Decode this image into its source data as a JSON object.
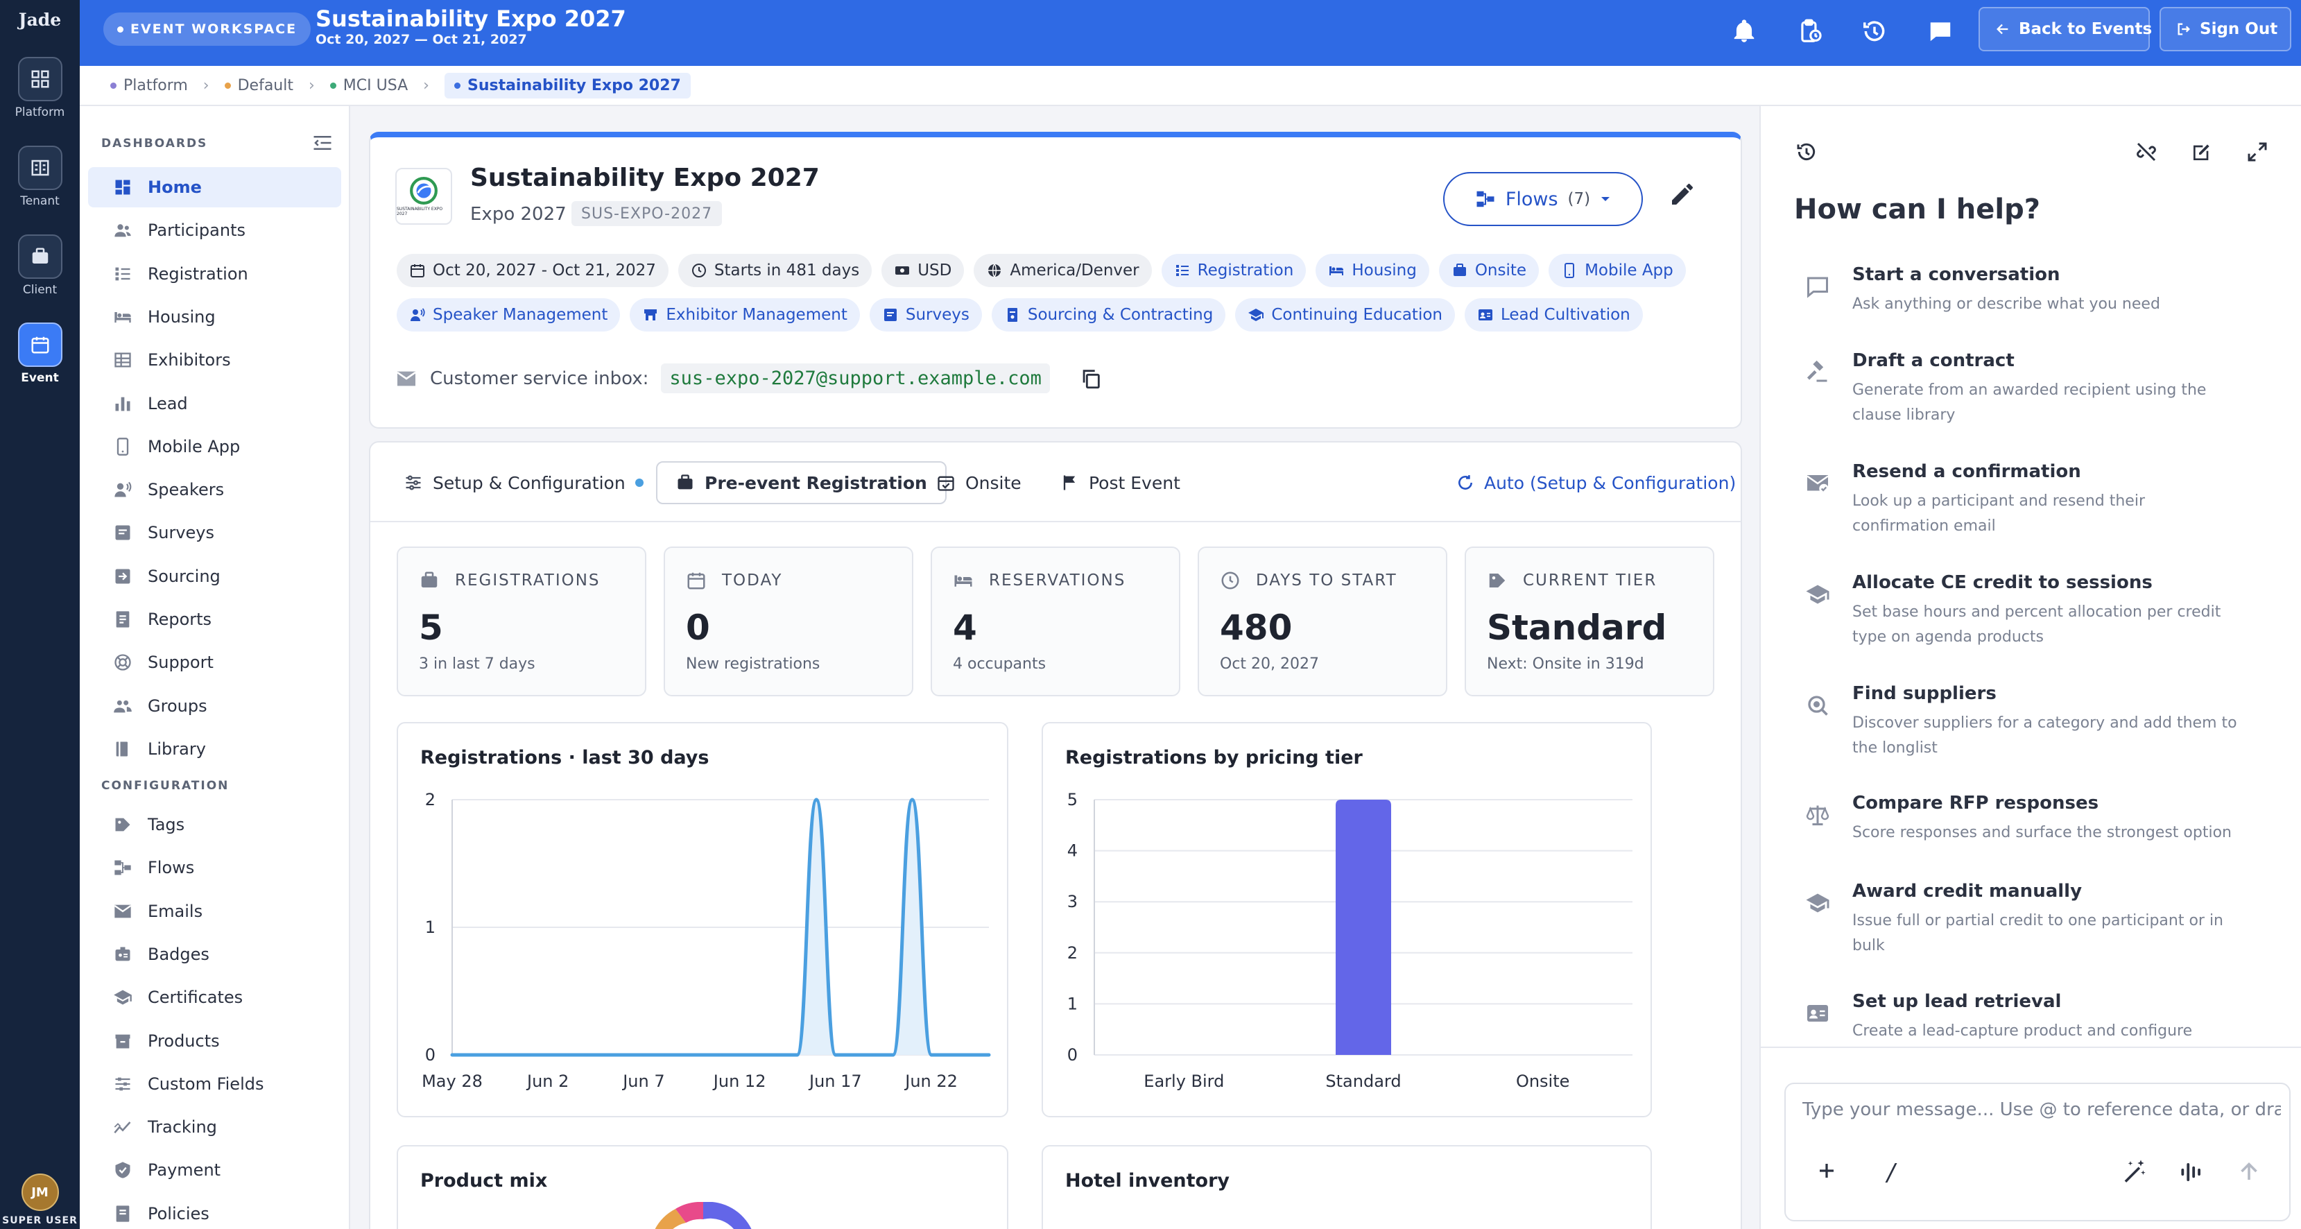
{
  "rail": {
    "logo": "Jade",
    "items": [
      {
        "label": "Platform",
        "icon": "grid-icon"
      },
      {
        "label": "Tenant",
        "icon": "building-icon"
      },
      {
        "label": "Client",
        "icon": "briefcase-icon"
      },
      {
        "label": "Event",
        "icon": "calendar-icon",
        "active": true
      }
    ],
    "user_initials": "JM",
    "user_role": "SUPER USER"
  },
  "topbar": {
    "workspace_label": "EVENT WORKSPACE",
    "title": "Sustainability Expo 2027",
    "dates": "Oct 20, 2027 — Oct 21, 2027",
    "back_label": "Back to Events",
    "signout_label": "Sign Out",
    "icons": [
      "bell-icon",
      "clipboard-clock-icon",
      "history-icon",
      "chat-icon"
    ]
  },
  "breadcrumb": [
    {
      "label": "Platform",
      "color": "#8b7fd4"
    },
    {
      "label": "Default",
      "color": "#e8a24a"
    },
    {
      "label": "MCI USA",
      "color": "#3daa78"
    },
    {
      "label": "Sustainability Expo 2027",
      "color": "#3b6ee0",
      "current": true
    }
  ],
  "sidebar": {
    "dashboards_heading": "DASHBOARDS",
    "configuration_heading": "CONFIGURATION",
    "dashboards": [
      {
        "label": "Home",
        "icon": "dashboard-icon",
        "active": true
      },
      {
        "label": "Participants",
        "icon": "people-icon"
      },
      {
        "label": "Registration",
        "icon": "registration-icon"
      },
      {
        "label": "Housing",
        "icon": "bed-icon"
      },
      {
        "label": "Exhibitors",
        "icon": "table-icon"
      },
      {
        "label": "Lead",
        "icon": "bar-chart-icon"
      },
      {
        "label": "Mobile App",
        "icon": "phone-icon"
      },
      {
        "label": "Speakers",
        "icon": "speaker-icon"
      },
      {
        "label": "Surveys",
        "icon": "survey-icon"
      },
      {
        "label": "Sourcing",
        "icon": "sourcing-icon"
      },
      {
        "label": "Reports",
        "icon": "report-icon"
      },
      {
        "label": "Support",
        "icon": "support-icon"
      },
      {
        "label": "Groups",
        "icon": "group-icon"
      },
      {
        "label": "Library",
        "icon": "library-icon"
      }
    ],
    "configuration": [
      {
        "label": "Tags",
        "icon": "tag-icon"
      },
      {
        "label": "Flows",
        "icon": "flow-icon"
      },
      {
        "label": "Emails",
        "icon": "email-icon"
      },
      {
        "label": "Badges",
        "icon": "badge-icon"
      },
      {
        "label": "Certificates",
        "icon": "certificate-icon"
      },
      {
        "label": "Products",
        "icon": "product-icon"
      },
      {
        "label": "Custom Fields",
        "icon": "sliders-icon"
      },
      {
        "label": "Tracking",
        "icon": "tracking-icon"
      },
      {
        "label": "Payment",
        "icon": "shield-icon"
      },
      {
        "label": "Policies",
        "icon": "policy-icon"
      }
    ]
  },
  "event": {
    "name": "Sustainability Expo 2027",
    "short_name": "Expo 2027",
    "code": "SUS-EXPO-2027",
    "logo_text": "SUSTAINABILITY EXPO 2027",
    "flows_label": "Flows",
    "flows_count": "(7)",
    "chips_row1": [
      {
        "label": "Oct 20, 2027 - Oct 21, 2027",
        "icon": "calendar-icon",
        "style": "gray"
      },
      {
        "label": "Starts in 481 days",
        "icon": "clock-icon",
        "style": "gray"
      },
      {
        "label": "USD",
        "icon": "money-icon",
        "style": "gray"
      },
      {
        "label": "America/Denver",
        "icon": "globe-icon",
        "style": "gray"
      },
      {
        "label": "Registration",
        "icon": "registration-icon",
        "style": "blue"
      },
      {
        "label": "Housing",
        "icon": "bed-icon",
        "style": "blue"
      },
      {
        "label": "Onsite",
        "icon": "briefcase-icon",
        "style": "blue"
      },
      {
        "label": "Mobile App",
        "icon": "phone-icon",
        "style": "blue"
      }
    ],
    "chips_row2": [
      {
        "label": "Speaker Management",
        "icon": "speaker-icon",
        "style": "blue"
      },
      {
        "label": "Exhibitor Management",
        "icon": "booth-icon",
        "style": "blue"
      },
      {
        "label": "Surveys",
        "icon": "survey-icon",
        "style": "blue"
      },
      {
        "label": "Sourcing & Contracting",
        "icon": "contract-icon",
        "style": "blue"
      },
      {
        "label": "Continuing Education",
        "icon": "mortarboard-icon",
        "style": "blue"
      },
      {
        "label": "Lead Cultivation",
        "icon": "id-card-icon",
        "style": "blue"
      }
    ],
    "inbox_label": "Customer service inbox:",
    "inbox_email": "sus-expo-2027@support.example.com"
  },
  "tabs": {
    "items": [
      {
        "label": "Setup & Configuration",
        "icon": "sliders-icon",
        "dot": true
      },
      {
        "label": "Pre-event Registration",
        "icon": "briefcase-icon",
        "selected": true
      },
      {
        "label": "Onsite",
        "icon": "calendar-check-icon"
      },
      {
        "label": "Post Event",
        "icon": "flag-icon"
      }
    ],
    "auto_label": "Auto (Setup & Configuration)"
  },
  "stats": [
    {
      "label": "REGISTRATIONS",
      "value": "5",
      "sub": "3 in last 7 days",
      "icon": "briefcase-icon"
    },
    {
      "label": "TODAY",
      "value": "0",
      "sub": "New registrations",
      "icon": "calendar-icon"
    },
    {
      "label": "RESERVATIONS",
      "value": "4",
      "sub": "4 occupants",
      "icon": "bed-icon"
    },
    {
      "label": "DAYS TO START",
      "value": "480",
      "sub": "Oct 20, 2027",
      "icon": "clock-icon"
    },
    {
      "label": "CURRENT TIER",
      "value": "Standard",
      "sub": "Next: Onsite in 319d",
      "icon": "tag-icon"
    }
  ],
  "chart_data": [
    {
      "type": "area",
      "title": "Registrations · last 30 days",
      "x": [
        "May 28",
        "May 29",
        "May 30",
        "May 31",
        "Jun 1",
        "Jun 2",
        "Jun 3",
        "Jun 4",
        "Jun 5",
        "Jun 6",
        "Jun 7",
        "Jun 8",
        "Jun 9",
        "Jun 10",
        "Jun 11",
        "Jun 12",
        "Jun 13",
        "Jun 14",
        "Jun 15",
        "Jun 16",
        "Jun 17",
        "Jun 18",
        "Jun 19",
        "Jun 20",
        "Jun 21",
        "Jun 22",
        "Jun 23",
        "Jun 24",
        "Jun 25"
      ],
      "x_ticks": [
        "May 28",
        "Jun 2",
        "Jun 7",
        "Jun 12",
        "Jun 17",
        "Jun 22"
      ],
      "values": [
        0,
        0,
        0,
        0,
        0,
        0,
        0,
        0,
        0,
        0,
        0,
        0,
        0,
        0,
        0,
        0,
        0,
        0,
        0,
        2,
        0,
        0,
        0,
        0,
        2,
        0,
        0,
        0,
        0
      ],
      "y_ticks": [
        "0",
        "1",
        "2"
      ],
      "ylim": [
        0,
        2
      ],
      "color": "#4a9fe0",
      "fill": "#e3f0fb",
      "grid": true
    },
    {
      "type": "bar",
      "title": "Registrations by pricing tier",
      "categories": [
        "Early Bird",
        "Standard",
        "Onsite"
      ],
      "values": [
        0,
        5,
        0
      ],
      "y_ticks": [
        "0",
        "1",
        "2",
        "3",
        "4",
        "5"
      ],
      "ylim": [
        0,
        5
      ],
      "color": "#6366e8",
      "grid": true
    }
  ],
  "bottom_cards": {
    "product_mix_title": "Product mix",
    "hotel_title": "Hotel inventory"
  },
  "assistant": {
    "heading": "How can I help?",
    "items": [
      {
        "title": "Start a conversation",
        "desc": "Ask anything or describe what you need",
        "icon": "chat-bubble-icon"
      },
      {
        "title": "Draft a contract",
        "desc": "Generate from an awarded recipient using the clause library",
        "icon": "gavel-icon"
      },
      {
        "title": "Resend a confirmation",
        "desc": "Look up a participant and resend their confirmation email",
        "icon": "mail-check-icon"
      },
      {
        "title": "Allocate CE credit to sessions",
        "desc": "Set base hours and percent allocation per credit type on agenda products",
        "icon": "mortarboard-icon"
      },
      {
        "title": "Find suppliers",
        "desc": "Discover suppliers for a category and add them to the longlist",
        "icon": "search-icon"
      },
      {
        "title": "Compare RFP responses",
        "desc": "Score responses and surface the strongest option",
        "icon": "scale-icon"
      },
      {
        "title": "Award credit manually",
        "desc": "Issue full or partial credit to one participant or in bulk",
        "icon": "mortarboard-icon"
      },
      {
        "title": "Set up lead retrieval",
        "desc": "Create a lead-capture product and configure",
        "icon": "id-card-icon"
      }
    ],
    "input_placeholder": "Type your message... Use @ to reference data, or drag a"
  }
}
